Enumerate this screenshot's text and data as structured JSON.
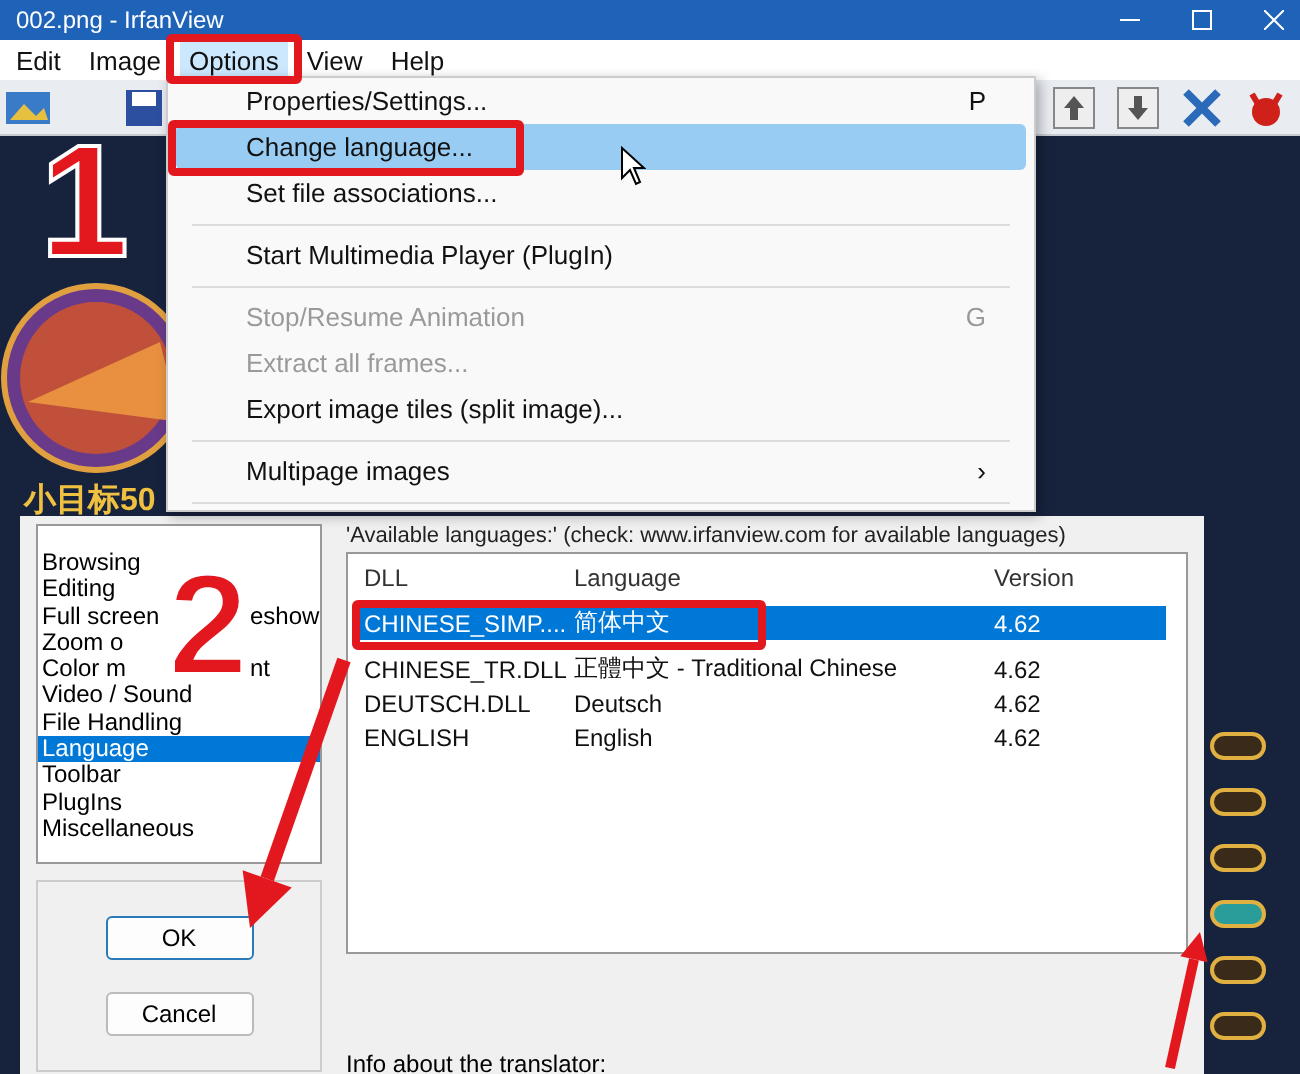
{
  "window": {
    "title": "002.png - IrfanView"
  },
  "menu_bar": [
    {
      "label": "Edit",
      "selected": false
    },
    {
      "label": "Image",
      "selected": false
    },
    {
      "label": "Options",
      "selected": true
    },
    {
      "label": "View",
      "selected": false
    },
    {
      "label": "Help",
      "selected": false
    }
  ],
  "options_menu": [
    {
      "kind": "item",
      "label": "Properties/Settings...",
      "shortcut": "P",
      "selected": false,
      "disabled": false
    },
    {
      "kind": "item",
      "label": "Change language...",
      "selected": true,
      "disabled": false
    },
    {
      "kind": "item",
      "label": "Set file associations...",
      "selected": false,
      "disabled": false
    },
    {
      "kind": "separator"
    },
    {
      "kind": "item",
      "label": "Start Multimedia Player (PlugIn)",
      "selected": false,
      "disabled": false
    },
    {
      "kind": "separator"
    },
    {
      "kind": "item",
      "label": "Stop/Resume Animation",
      "shortcut": "G",
      "selected": false,
      "disabled": true
    },
    {
      "kind": "item",
      "label": "Extract all frames...",
      "selected": false,
      "disabled": true
    },
    {
      "kind": "item",
      "label": "Export image tiles (split image)...",
      "selected": false,
      "disabled": false
    },
    {
      "kind": "separator"
    },
    {
      "kind": "submenu",
      "label": "Multipage images",
      "arrow": "›",
      "selected": false,
      "disabled": false
    },
    {
      "kind": "separator"
    }
  ],
  "background": {
    "caption": "小目标50",
    "toggles": [
      {
        "on": false
      },
      {
        "on": false
      },
      {
        "on": false
      },
      {
        "on": true
      },
      {
        "on": false
      },
      {
        "on": false
      }
    ]
  },
  "dialog": {
    "categories": [
      {
        "label": "Browsing",
        "selected": false
      },
      {
        "label": "Editing",
        "selected": false
      },
      {
        "label": "Full screen",
        "tail": "eshow",
        "selected": false
      },
      {
        "label": "Zoom o",
        "selected": false
      },
      {
        "label": "Color m",
        "tail": "nt",
        "selected": false
      },
      {
        "label": "Video / Sound",
        "selected": false
      },
      {
        "label": "File Handling",
        "selected": false
      },
      {
        "label": "Language",
        "selected": true
      },
      {
        "label": "Toolbar",
        "selected": false
      },
      {
        "label": "PlugIns",
        "selected": false
      },
      {
        "label": "Miscellaneous",
        "selected": false
      }
    ],
    "languages_label": "'Available languages:' (check: www.irfanview.com for available languages)",
    "table": {
      "columns": [
        "DLL",
        "Language",
        "Version"
      ],
      "rows": [
        {
          "cells": [
            "CHINESE_SIMP....",
            "简体中文",
            "4.62"
          ],
          "selected": true
        },
        {
          "cells": [
            "CHINESE_TR.DLL",
            "正體中文 - Traditional Chinese",
            "4.62"
          ],
          "selected": false
        },
        {
          "cells": [
            "DEUTSCH.DLL",
            "Deutsch",
            "4.62"
          ],
          "selected": false
        },
        {
          "cells": [
            "ENGLISH",
            "English",
            "4.62"
          ],
          "selected": false
        }
      ]
    },
    "buttons": [
      "OK",
      "Cancel"
    ],
    "info_label": "Info about the translator:"
  },
  "annotations": {
    "step_numbers": [
      "1",
      "2"
    ]
  }
}
